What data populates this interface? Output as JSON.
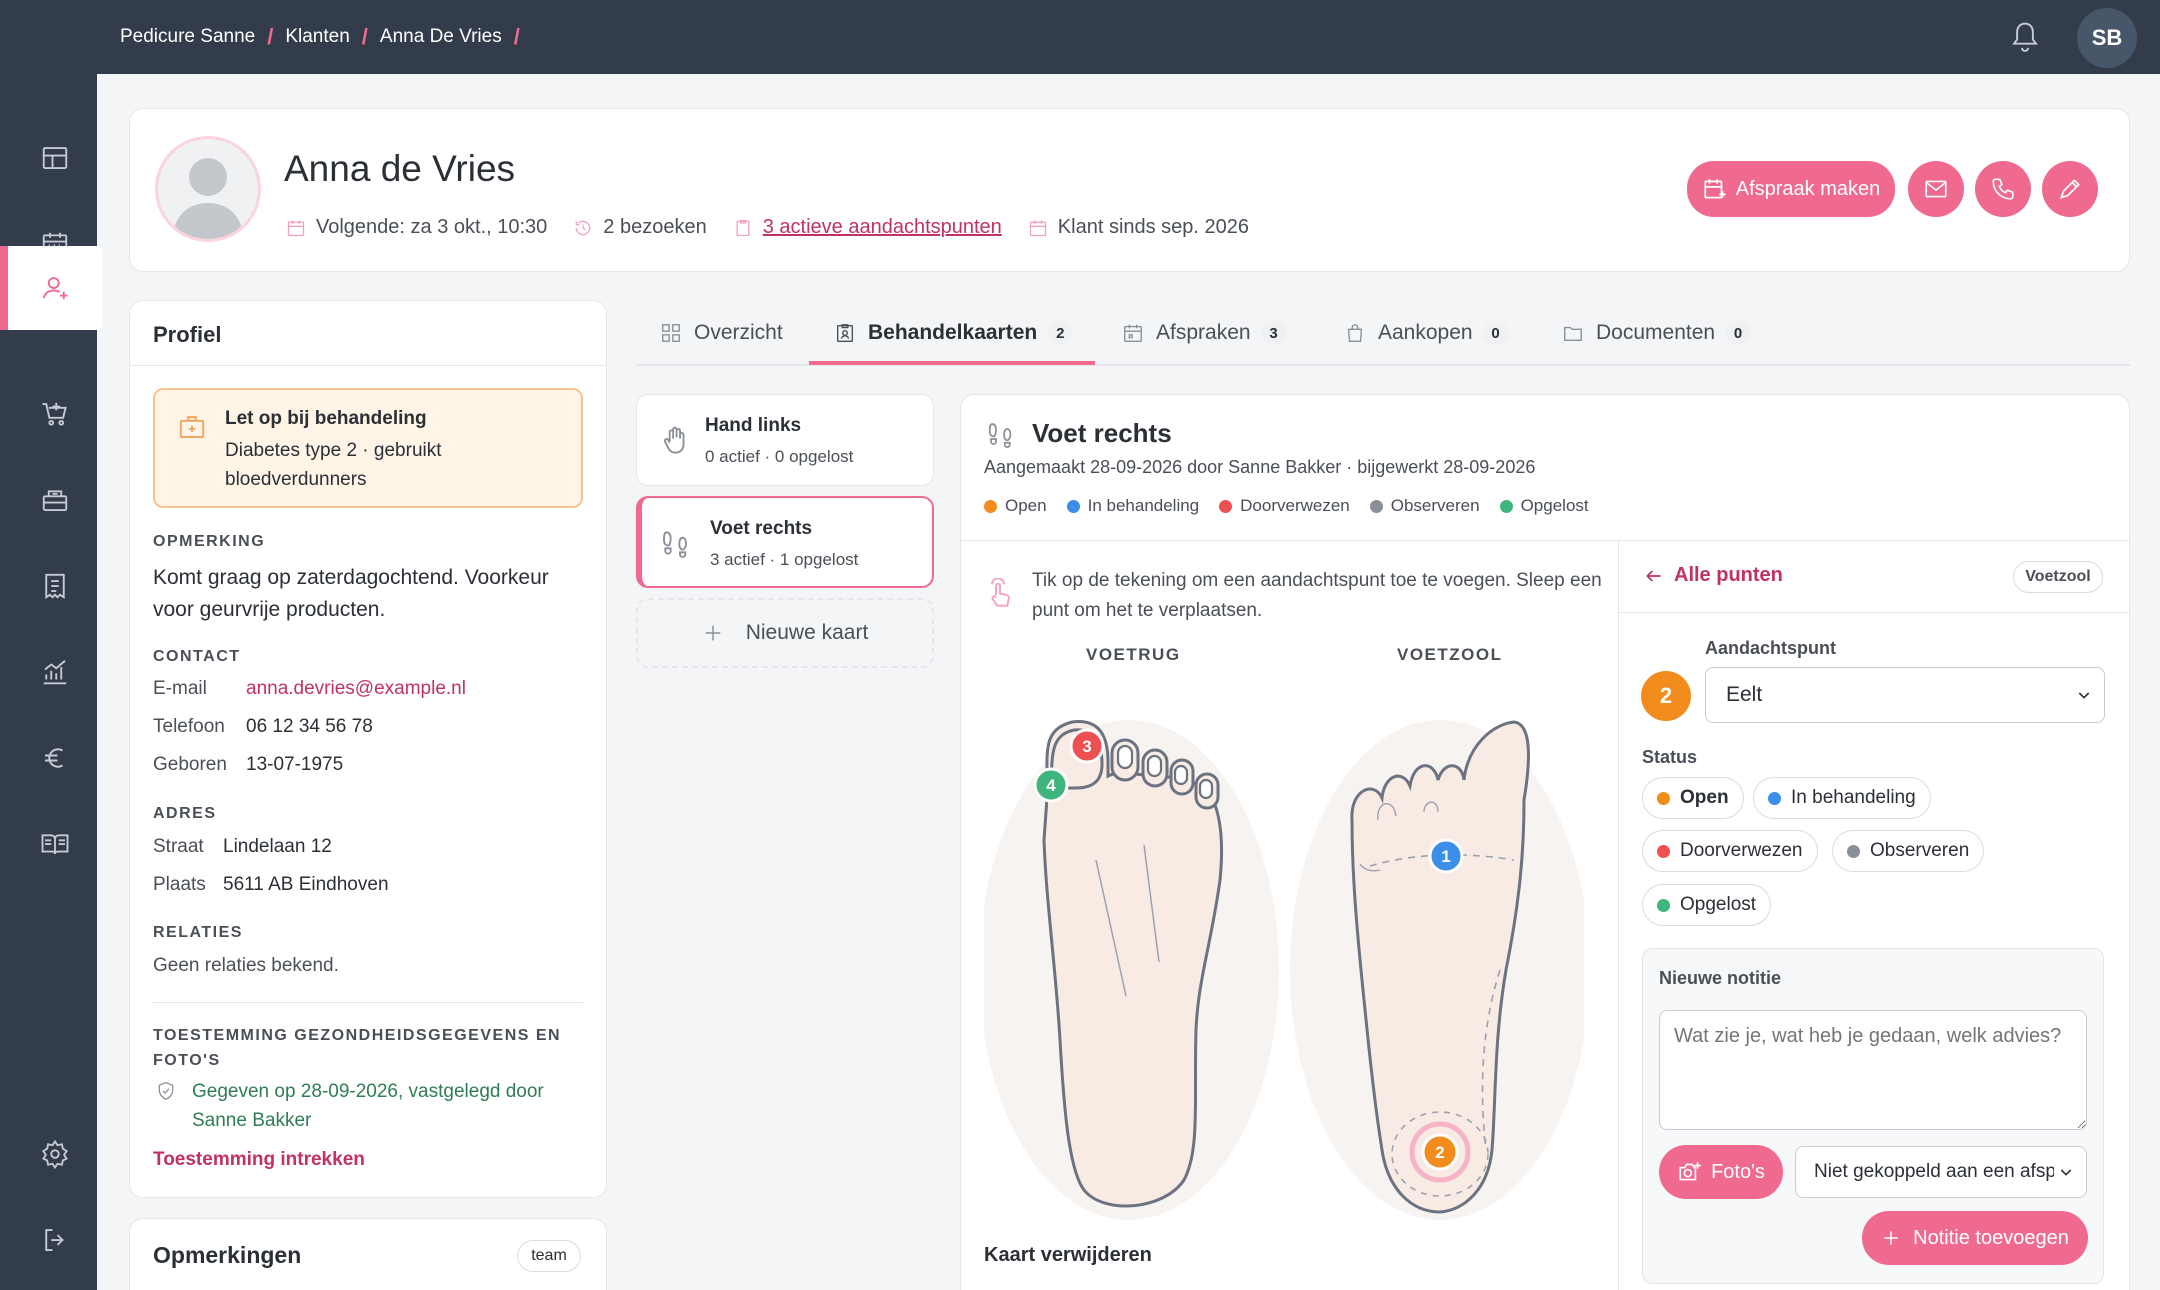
{
  "breadcrumb": [
    "Pedicure Sanne",
    "Klanten",
    "Anna De Vries"
  ],
  "user_initials": "SB",
  "client": {
    "name": "Anna de Vries",
    "next": "Volgende: za 3 okt., 10:30",
    "visits": "2 bezoeken",
    "attention_points": "3 actieve aandachtspunten",
    "since": "Klant sinds sep. 2026"
  },
  "actions": {
    "appointment": "Afspraak maken"
  },
  "profile": {
    "title": "Profiel",
    "warning_title": "Let op bij behandeling",
    "warning_text": "Diabetes type 2 · gebruikt bloedverdunners",
    "remark_label": "OPMERKING",
    "remark": "Komt graag op zaterdagochtend. Voorkeur voor geurvrije producten.",
    "contact_label": "CONTACT",
    "email_label": "E-mail",
    "email": "anna.devries@example.nl",
    "phone_label": "Telefoon",
    "phone": "06 12 34 56 78",
    "born_label": "Geboren",
    "born": "13-07-1975",
    "address_label": "ADRES",
    "street_label": "Straat",
    "street": "Lindelaan 12",
    "city_label": "Plaats",
    "city": "5611 AB Eindhoven",
    "relations_label": "RELATIES",
    "relations": "Geen relaties bekend.",
    "consent_label": "TOESTEMMING GEZONDHEIDSGEGEVENS EN FOTO'S",
    "consent": "Gegeven op 28-09-2026, vastgelegd door Sanne Bakker",
    "revoke": "Toestemming intrekken"
  },
  "remarks": {
    "title": "Opmerkingen",
    "badge": "team"
  },
  "tabs": [
    {
      "label": "Overzicht",
      "count": ""
    },
    {
      "label": "Behandelkaarten",
      "count": "2"
    },
    {
      "label": "Afspraken",
      "count": "3"
    },
    {
      "label": "Aankopen",
      "count": "0"
    },
    {
      "label": "Documenten",
      "count": "0"
    }
  ],
  "maps": [
    {
      "name": "Hand links",
      "summary": "0 actief · 0 opgelost"
    },
    {
      "name": "Voet rechts",
      "summary": "3 actief · 1 opgelost"
    }
  ],
  "new_map": "Nieuwe kaart",
  "map": {
    "title": "Voet rechts",
    "meta": "Aangemaakt 28-09-2026 door Sanne Bakker · bijgewerkt 28-09-2026",
    "legend": [
      {
        "label": "Open",
        "color": "#f28c1c"
      },
      {
        "label": "In behandeling",
        "color": "#3b8fe8"
      },
      {
        "label": "Doorverwezen",
        "color": "#ec5050"
      },
      {
        "label": "Observeren",
        "color": "#8a8f98"
      },
      {
        "label": "Opgelost",
        "color": "#3fb57e"
      }
    ],
    "hint": "Tik op de tekening om een aandachtspunt toe te voegen. Sleep een punt om het te verplaatsen.",
    "dorsal_label": "VOETRUG",
    "plantar_label": "VOETZOOL",
    "markers": [
      "3",
      "4",
      "1",
      "2"
    ],
    "delete": "Kaart verwijderen"
  },
  "detail": {
    "back": "Alle punten",
    "location_badge": "Voetzool",
    "point_label": "Aandachtspunt",
    "point_number": "2",
    "point_value": "Eelt",
    "status_label": "Status",
    "statuses": [
      {
        "label": "Open",
        "color": "#f28c1c"
      },
      {
        "label": "In behandeling",
        "color": "#3b8fe8"
      },
      {
        "label": "Doorverwezen",
        "color": "#ec5050"
      },
      {
        "label": "Observeren",
        "color": "#8a8f98"
      },
      {
        "label": "Opgelost",
        "color": "#3fb57e"
      }
    ],
    "note_label": "Nieuwe notitie",
    "note_placeholder": "Wat zie je, wat heb je gedaan, welk advies?",
    "photos": "Foto's",
    "link_select": "Niet gekoppeld aan een afspraak",
    "add_note": "Notitie toevoegen"
  }
}
